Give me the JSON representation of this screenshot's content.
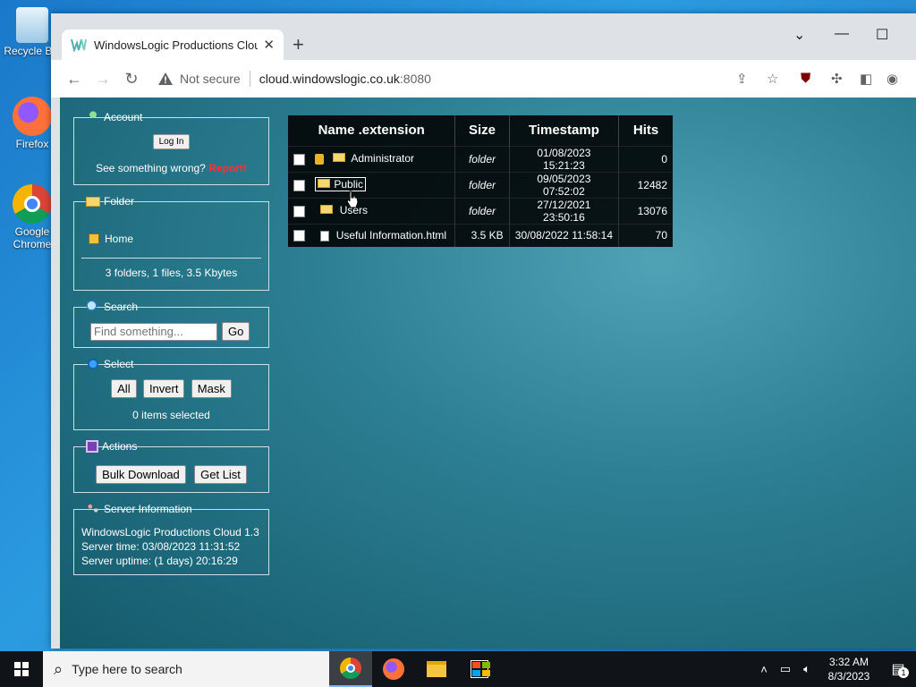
{
  "desktop": {
    "icons": [
      {
        "label": "Recycle Bin"
      },
      {
        "label": "Firefox"
      },
      {
        "label": "Google Chrome"
      }
    ]
  },
  "browser": {
    "tab_title": "WindowsLogic Productions Cloud",
    "not_secure": "Not secure",
    "url_host": "cloud.windowslogic.co.uk",
    "url_port": ":8080"
  },
  "sidebar": {
    "account": {
      "title": "Account",
      "login_label": "Log In",
      "wrong_text": "See something wrong?",
      "report_label": "Report!"
    },
    "folder": {
      "title": "Folder",
      "home_label": "Home",
      "summary": "3 folders, 1 files, 3.5 Kbytes"
    },
    "search": {
      "title": "Search",
      "placeholder": "Find something...",
      "go_label": "Go"
    },
    "select": {
      "title": "Select",
      "all_label": "All",
      "invert_label": "Invert",
      "mask_label": "Mask",
      "status": "0 items selected"
    },
    "actions": {
      "title": "Actions",
      "bulk_label": "Bulk Download",
      "getlist_label": "Get List"
    },
    "server": {
      "title": "Server Information",
      "line1": "WindowsLogic Productions Cloud 1.3",
      "line2": "Server time: 03/08/2023 11:31:52",
      "line3": "Server uptime: (1 days) 20:16:29"
    }
  },
  "files": {
    "headers": {
      "name": "Name .extension",
      "size": "Size",
      "timestamp": "Timestamp",
      "hits": "Hits"
    },
    "rows": [
      {
        "name": "Administrator",
        "size": "folder",
        "timestamp": "01/08/2023 15:21:23",
        "hits": "0"
      },
      {
        "name": "Public",
        "size": "folder",
        "timestamp": "09/05/2023 07:52:02",
        "hits": "12482"
      },
      {
        "name": "Users",
        "size": "folder",
        "timestamp": "27/12/2021 23:50:16",
        "hits": "13076"
      },
      {
        "name": "Useful Information.html",
        "size": "3.5 KB",
        "timestamp": "30/08/2022 11:58:14",
        "hits": "70"
      }
    ]
  },
  "taskbar": {
    "search_placeholder": "Type here to search",
    "time": "3:32 AM",
    "date": "8/3/2023",
    "notif_count": "1"
  }
}
